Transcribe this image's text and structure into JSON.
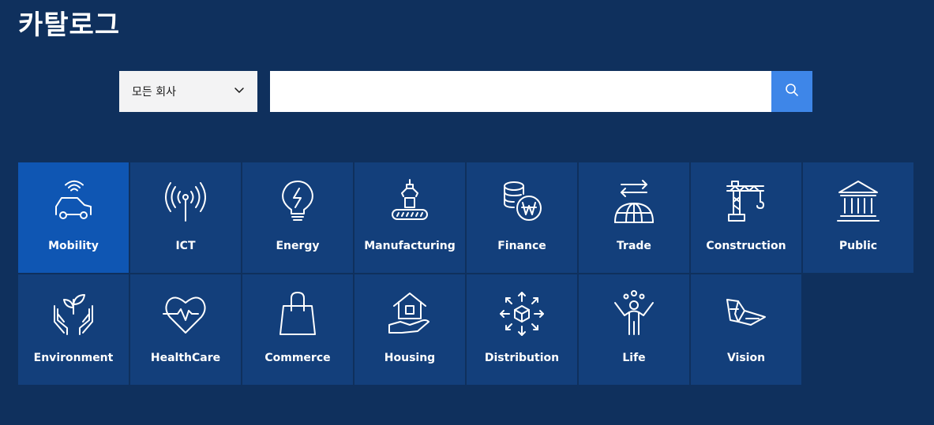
{
  "page": {
    "title": "카탈로그"
  },
  "search": {
    "company_select_value": "모든 회사",
    "query": "",
    "placeholder": ""
  },
  "colors": {
    "background": "#0f305d",
    "tile": "#133f7b",
    "tile_active": "#0f56b3",
    "search_button": "#3e86e8"
  },
  "categories": [
    {
      "label": "Mobility",
      "icon": "car-wifi-icon",
      "active": true
    },
    {
      "label": "ICT",
      "icon": "antenna-icon",
      "active": false
    },
    {
      "label": "Energy",
      "icon": "bulb-bolt-icon",
      "active": false
    },
    {
      "label": "Manufacturing",
      "icon": "robot-arm-conveyor-icon",
      "active": false
    },
    {
      "label": "Finance",
      "icon": "coins-won-icon",
      "active": false
    },
    {
      "label": "Trade",
      "icon": "globe-arrows-icon",
      "active": false
    },
    {
      "label": "Construction",
      "icon": "crane-icon",
      "active": false
    },
    {
      "label": "Public",
      "icon": "government-building-icon",
      "active": false
    },
    {
      "label": "Environment",
      "icon": "hands-sprout-icon",
      "active": false
    },
    {
      "label": "HealthCare",
      "icon": "heart-pulse-icon",
      "active": false
    },
    {
      "label": "Commerce",
      "icon": "shopping-bag-icon",
      "active": false
    },
    {
      "label": "Housing",
      "icon": "hand-house-icon",
      "active": false
    },
    {
      "label": "Distribution",
      "icon": "box-arrows-icon",
      "active": false
    },
    {
      "label": "Life",
      "icon": "person-celebrate-icon",
      "active": false
    },
    {
      "label": "Vision",
      "icon": "drone-icon",
      "active": false
    }
  ]
}
